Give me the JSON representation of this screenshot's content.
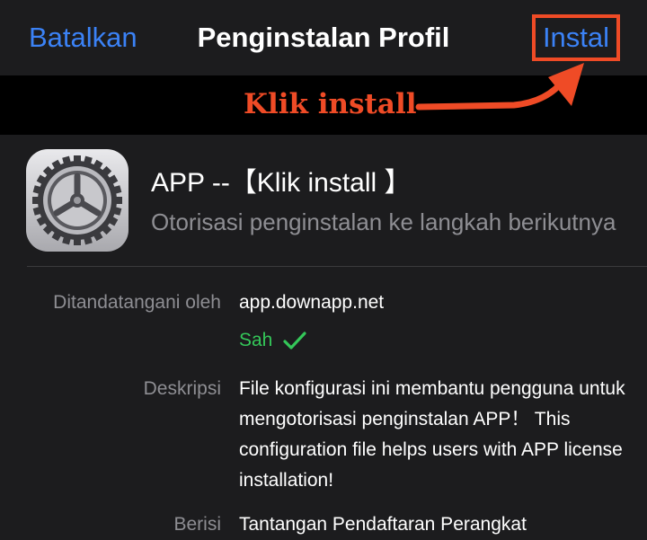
{
  "navbar": {
    "cancel_label": "Batalkan",
    "title": "Penginstalan Profil",
    "install_label": "Instal"
  },
  "annotation": {
    "text": "Klik install",
    "color": "#ef4b26"
  },
  "profile": {
    "name": "APP --【Klik install 】",
    "subtitle": "Otorisasi penginstalan ke langkah berikutnya",
    "icon": "settings-gear-icon"
  },
  "details": {
    "signed_by_label": "Ditandatangani oleh",
    "signed_by_value": "app.downapp.net",
    "verified_label": "Sah",
    "verified_icon": "checkmark-icon",
    "description_label": "Deskripsi",
    "description_value": "File konfigurasi ini membantu pengguna untuk mengotorisasi penginstalan APP！ This configuration file helps users with APP license installation!",
    "contains_label": "Berisi",
    "contains_value": "Tantangan Pendaftaran Perangkat"
  },
  "colors": {
    "accent": "#3b82f6",
    "background": "#1c1c1e",
    "verified": "#34c759",
    "highlight": "#ef4b26"
  }
}
